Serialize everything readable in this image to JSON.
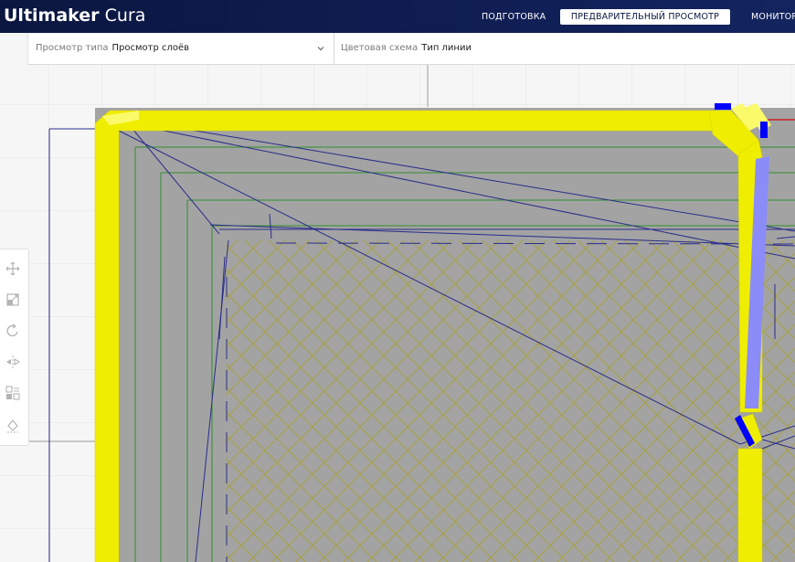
{
  "app": {
    "brand_bold": "Ultimaker",
    "brand_light": " Cura"
  },
  "stages": [
    {
      "label": "ПОДГОТОВКА",
      "active": false
    },
    {
      "label": "ПРЕДВАРИТЕЛЬНЫЙ ПРОСМОТР",
      "active": true
    },
    {
      "label": "МОНИТОР",
      "active": false
    }
  ],
  "view_settings": {
    "view_type_label": "Просмотр типа",
    "view_type_value": "Просмотр слоёв",
    "color_scheme_label": "Цветовая схема",
    "color_scheme_value": "Тип линии"
  },
  "tools": [
    {
      "icon": "move-icon"
    },
    {
      "icon": "scale-icon"
    },
    {
      "icon": "rotate-icon"
    },
    {
      "icon": "mirror-icon"
    },
    {
      "icon": "per-model-settings-icon"
    },
    {
      "icon": "support-blocker-icon"
    }
  ],
  "colors": {
    "header_bg": "#0f1d52",
    "wall_outer": "#f0ee00",
    "travel": "#2b2d8a",
    "retraction": "#0000ff",
    "support_skirt": "#8b8cf8",
    "infill": "#a6a236",
    "inner_wall": "#2f8f2f",
    "build_plate_grid": "#e6e6e6",
    "layer_fill": "#a3a3a3"
  }
}
